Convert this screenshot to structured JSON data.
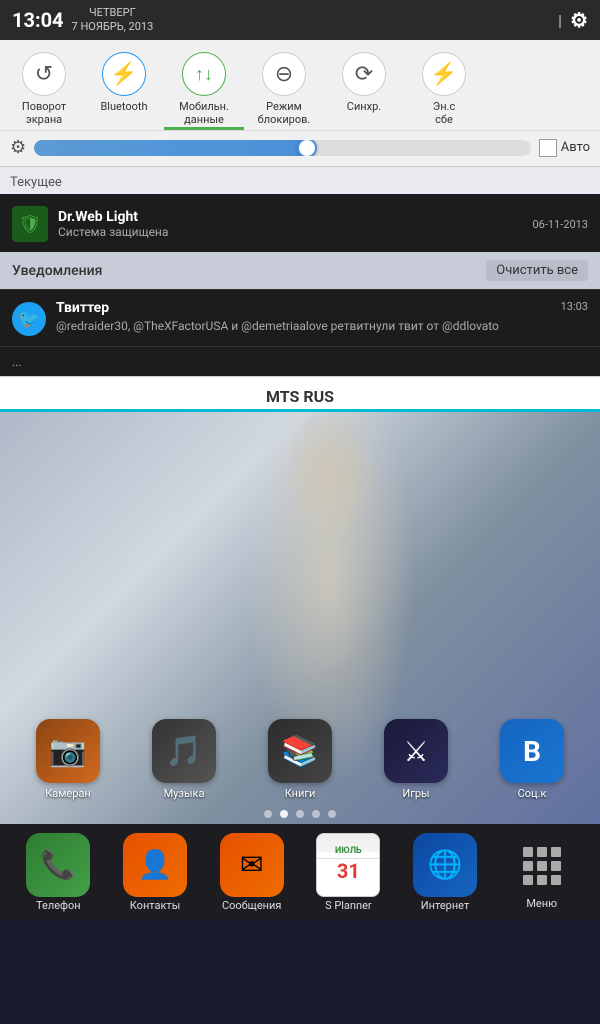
{
  "statusBar": {
    "time": "13:04",
    "dayLabel": "ЧЕТВЕРГ",
    "dateLabel": "7 НОЯБРЬ, 2013"
  },
  "quickSettings": {
    "items": [
      {
        "id": "rotation",
        "label": "Поворот\nэкрана",
        "icon": "↺",
        "active": false
      },
      {
        "id": "bluetooth",
        "label": "Bluetooth",
        "icon": "⚡",
        "active": true
      },
      {
        "id": "mobile-data",
        "label": "Мобильн.\nданные",
        "icon": "↑↓",
        "active": true,
        "green": true
      },
      {
        "id": "block-mode",
        "label": "Режим\nблокиров.",
        "icon": "⊖",
        "active": false
      },
      {
        "id": "sync",
        "label": "Синхр.",
        "icon": "⟳",
        "active": false
      },
      {
        "id": "power-save",
        "label": "Энс\nсбе",
        "icon": "⚡",
        "active": false
      }
    ]
  },
  "brightness": {
    "gearIcon": "⚙",
    "autoLabel": "Авто",
    "value": 55
  },
  "current": {
    "sectionTitle": "Текущее",
    "drweb": {
      "title": "Dr.Web Light",
      "subtitle": "Система защищена",
      "date": "06-11-2013",
      "icon": "🛡"
    }
  },
  "notifications": {
    "sectionTitle": "Уведомления",
    "clearLabel": "Очистить все",
    "items": [
      {
        "id": "twitter",
        "appName": "Твиттер",
        "time": "13:03",
        "body": "@redraider30, @TheXFactorUSA и @demetriaalove ретвитнули твит от @ddlovato",
        "icon": "🐦"
      },
      {
        "id": "other",
        "body": "..."
      }
    ]
  },
  "carrier": {
    "name": "MTS RUS"
  },
  "homeScreen": {
    "appIcons": [
      {
        "id": "camera",
        "label": "Камеран",
        "icon": "📷",
        "colorClass": "icon-camera"
      },
      {
        "id": "music",
        "label": "Музыка",
        "icon": "🎵",
        "colorClass": "icon-music"
      },
      {
        "id": "books",
        "label": "Книги",
        "icon": "📚",
        "colorClass": "icon-books"
      },
      {
        "id": "games",
        "label": "Игры",
        "icon": "🎮",
        "colorClass": "icon-games"
      },
      {
        "id": "social",
        "label": "Соц.к",
        "icon": "В",
        "colorClass": "icon-social"
      }
    ],
    "pageIndicators": [
      {
        "active": false
      },
      {
        "active": true
      },
      {
        "active": false
      },
      {
        "active": false
      },
      {
        "active": false
      }
    ],
    "dock": [
      {
        "id": "phone",
        "label": "Телефон",
        "icon": "📞",
        "colorClass": "icon-phone"
      },
      {
        "id": "contacts",
        "label": "Контакты",
        "icon": "👤",
        "colorClass": "icon-contacts"
      },
      {
        "id": "messages",
        "label": "Сообщения",
        "icon": "✉",
        "colorClass": "icon-messages"
      },
      {
        "id": "planner",
        "label": "S Planner",
        "icon": "31",
        "colorClass": "icon-planner"
      },
      {
        "id": "browser",
        "label": "Интернет",
        "icon": "🌐",
        "colorClass": "icon-browser"
      },
      {
        "id": "menu",
        "label": "Меню",
        "icon": "",
        "colorClass": "icon-menu"
      }
    ]
  }
}
